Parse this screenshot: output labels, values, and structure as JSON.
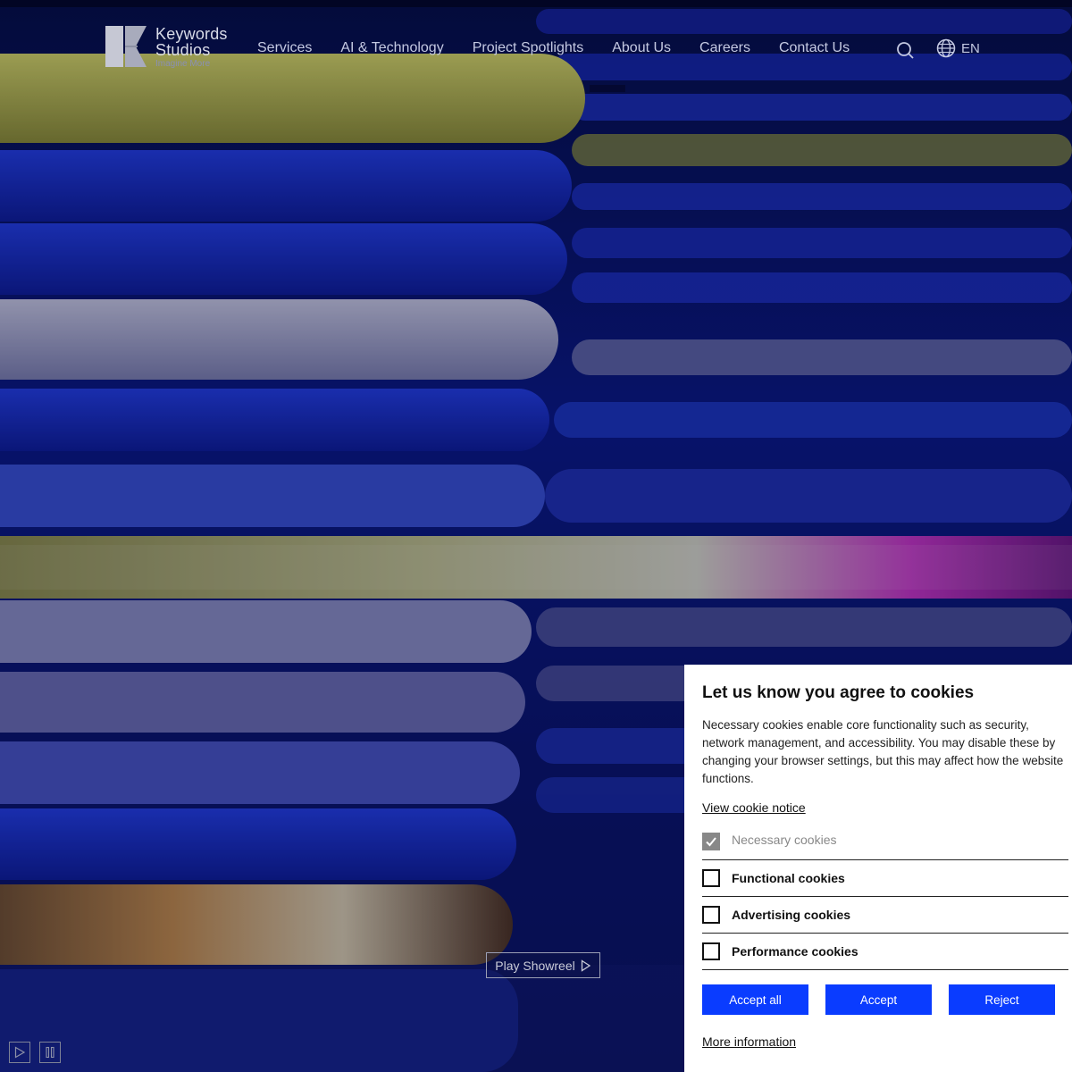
{
  "brand": {
    "name_line1": "Keywords",
    "name_line2": "Studios",
    "tagline": "Imagine More"
  },
  "nav": {
    "items": [
      "Services",
      "AI & Technology",
      "Project Spotlights",
      "About Us",
      "Careers",
      "Contact Us"
    ],
    "language": "EN"
  },
  "hero": {
    "showreel_label": "Play Showreel"
  },
  "cookie_banner": {
    "title": "Let us know you agree to cookies",
    "body": "Necessary cookies enable core functionality such as security, network management, and accessibility. You may disable these by changing your browser settings, but this may affect how the website functions.",
    "notice_link": "View cookie notice",
    "options": [
      {
        "label": "Necessary cookies",
        "checked": true,
        "disabled": true
      },
      {
        "label": "Functional cookies",
        "checked": false,
        "disabled": false
      },
      {
        "label": "Advertising cookies",
        "checked": false,
        "disabled": false
      },
      {
        "label": "Performance cookies",
        "checked": false,
        "disabled": false
      }
    ],
    "buttons": {
      "accept_all": "Accept all",
      "accept": "Accept",
      "reject": "Reject"
    },
    "more_link": "More information"
  },
  "colors": {
    "primary_button": "#0a3cff",
    "hero_blue": "#1a2fd6",
    "hero_yellow": "#c9cc5a"
  }
}
